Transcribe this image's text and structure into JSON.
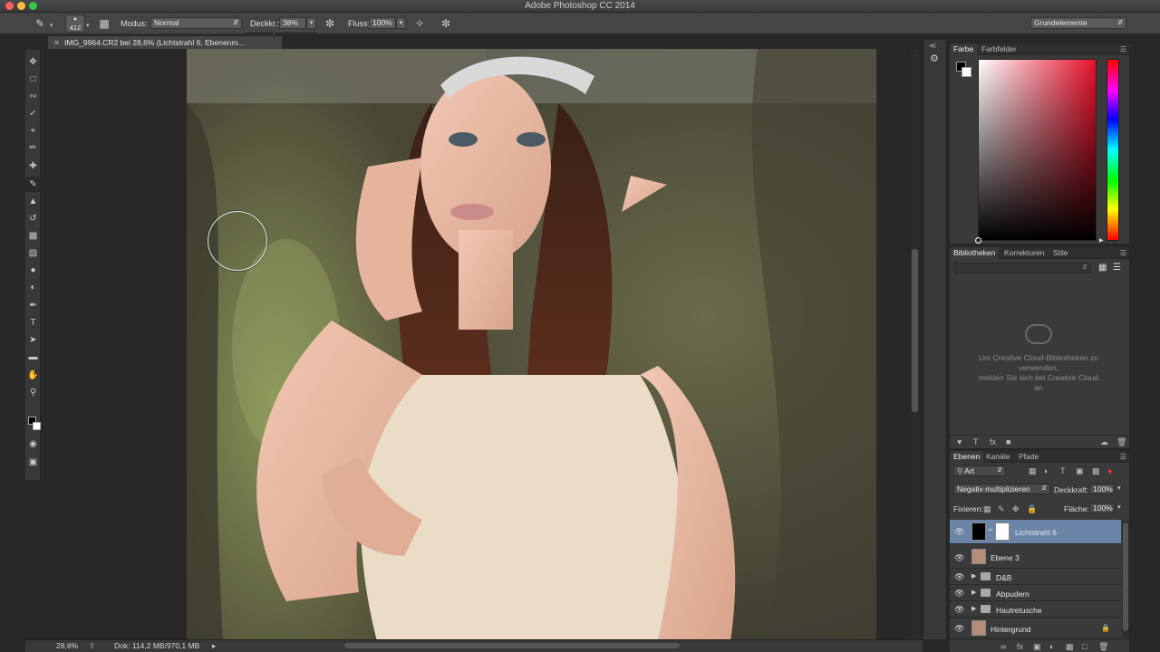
{
  "app": {
    "title": "Adobe Photoshop CC 2014"
  },
  "options_bar": {
    "brush_size": "412",
    "mode_label": "Modus:",
    "mode_value": "Normal",
    "opacity_label": "Deckkr.:",
    "opacity_value": "38%",
    "flow_label": "Fluss:",
    "flow_value": "100%",
    "workspace": "Grundelemente"
  },
  "document": {
    "tab_title": "IMG_9964.CR2 bei 28,6% (Lichtstrahl 6, Ebenenm..."
  },
  "status_bar": {
    "zoom": "28,6%",
    "doc_info": "Dok: 114,2 MB/970,1 MB"
  },
  "color_panel": {
    "tabs": [
      "Farbe",
      "Farbfelder"
    ],
    "foreground": "#000000",
    "background": "#ffffff"
  },
  "libraries_panel": {
    "tabs": [
      "Bibliotheken",
      "Korrekturen",
      "Stile"
    ],
    "message_lines": [
      "Um Creative Cloud-Bibliotheken zu",
      "verwenden,",
      "melden Sie sich bei Creative Cloud",
      "an"
    ]
  },
  "layers_panel": {
    "tabs": [
      "Ebenen",
      "Kanäle",
      "Pfade"
    ],
    "filter": "Art",
    "blend_mode": "Negativ multiplizieren",
    "opacity_label": "Deckkraft:",
    "opacity_value": "100%",
    "lock_label": "Fixieren:",
    "fill_label": "Fläche:",
    "fill_value": "100%",
    "layers": [
      {
        "name": "Lichtstrahl 6",
        "selected": true
      },
      {
        "name": "Ebene 3"
      },
      {
        "name": "D&B"
      },
      {
        "name": "Abpudern"
      },
      {
        "name": "Hautretusche"
      },
      {
        "name": "Hintergrund"
      }
    ]
  }
}
